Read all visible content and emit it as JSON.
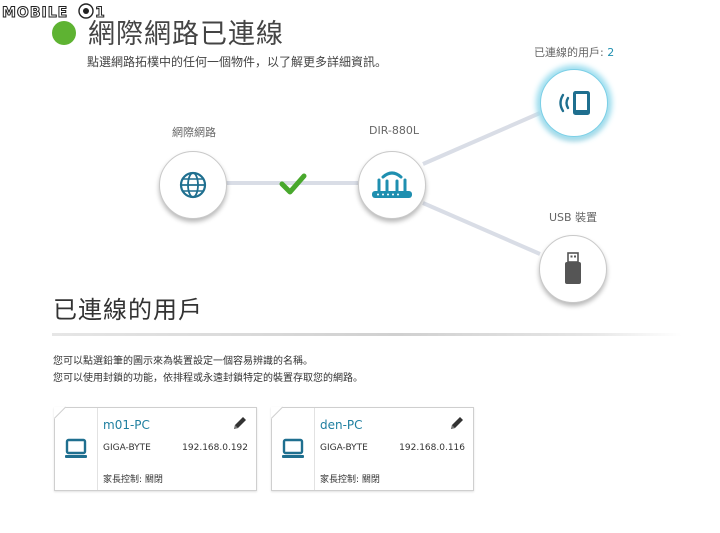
{
  "watermark": {
    "text": "MOBILE01"
  },
  "header": {
    "title": "網際網路已連線",
    "subtitle": "點選網路拓樸中的任何一個物件，以了解更多詳細資訊。",
    "status_color": "#5eb332"
  },
  "topology": {
    "internet_label": "網際網路",
    "router_label": "DIR-880L",
    "clients_label": "已連線的用戶: ",
    "clients_count": "2",
    "usb_label": "USB 裝置",
    "accent_color": "#1f8fb0"
  },
  "clients_section": {
    "title": "已連線的用戶",
    "info_line1": "您可以點選鉛筆的圖示來為裝置設定一個容易辨識的名稱。",
    "info_line2": "您可以使用封鎖的功能，依排程或永遠封鎖特定的裝置存取您的網路。"
  },
  "devices": [
    {
      "name": "m01-PC",
      "vendor": "GIGA-BYTE",
      "ip": "192.168.0.192",
      "parental_label": "家長控制:",
      "parental_value": "關閉"
    },
    {
      "name": "den-PC",
      "vendor": "GIGA-BYTE",
      "ip": "192.168.0.116",
      "parental_label": "家長控制:",
      "parental_value": "關閉"
    }
  ]
}
